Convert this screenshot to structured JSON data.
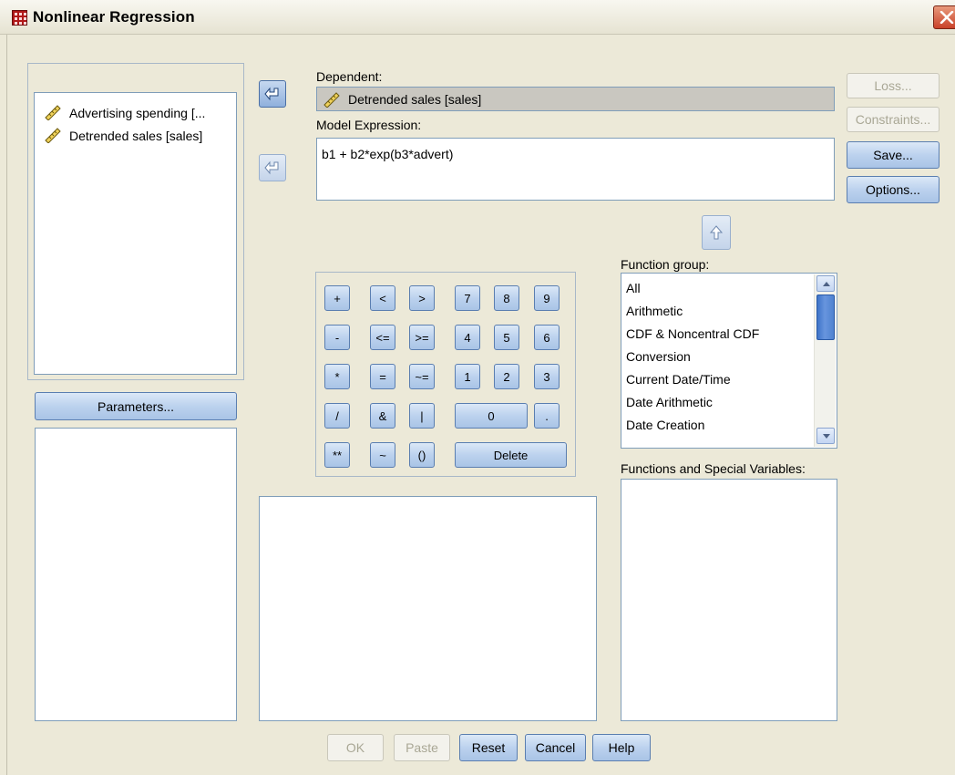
{
  "window": {
    "title": "Nonlinear Regression",
    "close_icon": "close-icon"
  },
  "variables": [
    {
      "name": "Advertising spending [...",
      "icon": "scale-ruler-icon"
    },
    {
      "name": "Detrended sales [sales]",
      "icon": "scale-ruler-icon"
    }
  ],
  "parameters_button": "Parameters...",
  "dependent": {
    "label": "Dependent:",
    "value": "Detrended sales [sales]"
  },
  "model_expression": {
    "label": "Model Expression:",
    "value": "b1 + b2*exp(b3*advert)"
  },
  "side_buttons": {
    "loss": "Loss...",
    "constraints": "Constraints...",
    "save": "Save...",
    "options": "Options..."
  },
  "calculator": {
    "keys": [
      "+",
      "<",
      ">",
      "7",
      "8",
      "9",
      "-",
      "<=",
      ">=",
      "4",
      "5",
      "6",
      "*",
      "=",
      "~=",
      "1",
      "2",
      "3",
      "/",
      "&",
      "|",
      "0",
      ".",
      "**",
      "~",
      "()",
      "Delete"
    ]
  },
  "function_group": {
    "label": "Function group:",
    "items": [
      "All",
      "Arithmetic",
      "CDF & Noncentral CDF",
      "Conversion",
      "Current Date/Time",
      "Date Arithmetic",
      "Date Creation"
    ]
  },
  "functions_label": "Functions and Special Variables:",
  "footer": {
    "ok": "OK",
    "paste": "Paste",
    "reset": "Reset",
    "cancel": "Cancel",
    "help": "Help"
  }
}
